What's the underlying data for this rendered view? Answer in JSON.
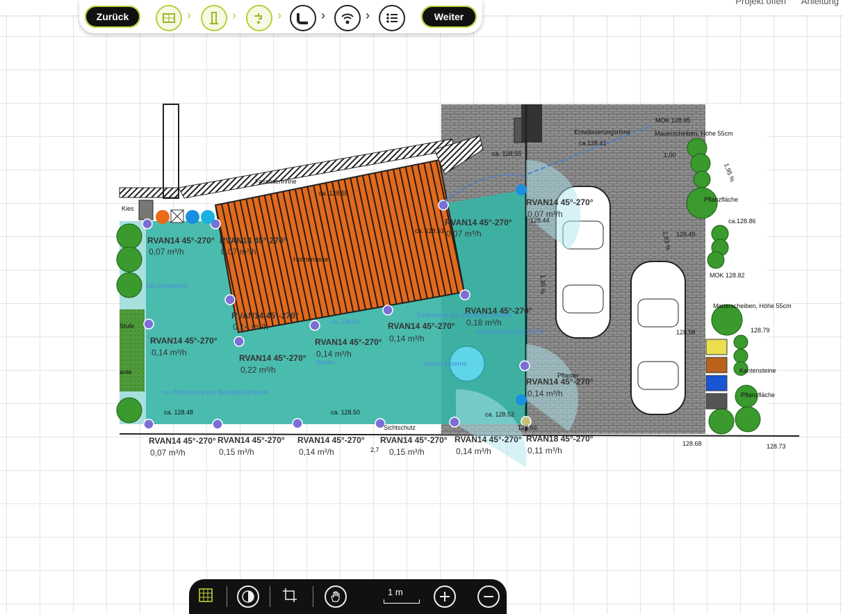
{
  "toplinks": [
    "Projekt öffen",
    "Anleitung"
  ],
  "wizard": {
    "back_label": "Zurück",
    "next_label": "Weiter",
    "steps": [
      {
        "icon": "area-icon",
        "state": "done"
      },
      {
        "icon": "water-source-icon",
        "state": "done"
      },
      {
        "icon": "tap-icon",
        "state": "done"
      },
      {
        "icon": "pipe-icon",
        "state": "todo"
      },
      {
        "icon": "wifi-drop-icon",
        "state": "todo"
      },
      {
        "icon": "list-icon",
        "state": "todo"
      }
    ]
  },
  "plan": {
    "areas": {
      "terrace": "Holzterrasse",
      "lawn": "Rasen",
      "cistern_cover": "Deckel Zisterne",
      "gutter": "Fassadenrinne",
      "gravel": "Kies",
      "step": "Stufe",
      "edge": "ante",
      "privacy": "KD-Sichtschutz",
      "privacy_bottom": "Sichtschutz",
      "border_top": "Einfassung aus Basaltgroßpflaster",
      "border_bottom": "ev- Einfassung aus Basaltgroßpflaster",
      "kantensteine_ok": "Kantensteine OK 128.52",
      "drain": "Entwässerungsrinne",
      "paving": "Pflaster",
      "wall_top": "Mauerscheiben, Höhe 55cm",
      "wall_mid": "Mauerscheiben, Höhe 55cm",
      "plant_top": "Pflanzfläche",
      "plant_bottom": "Pflanzfläche",
      "kanten_right": "Kantensteine",
      "mok_top": "MOK 128.95",
      "mok_mid": "MOK 128.82"
    },
    "heights": {
      "h1": "ca. 128.55",
      "h2": "ca. 128.55",
      "h3": "ca. 128.53",
      "h4": "ca.128.41",
      "h5": "ca. 128.50",
      "h6": "ca. 128.48",
      "h7": "ca. 128.50",
      "h8": "ca. 128.52",
      "h9": "128.44",
      "h10": "128.49",
      "h11": "128.58",
      "h12": "ca.128.86",
      "h13": "128.79",
      "h14": "128.68",
      "h15": "128.73",
      "h16": "128.63",
      "h17": "1,00",
      "h18": "2,7"
    },
    "slopes": [
      "1,95 %",
      "2,93 %",
      "1,35 %"
    ],
    "sprinklers": [
      {
        "model": "RVAN14 45°-270°",
        "flow": "0,07 m³/h"
      },
      {
        "model": "RVAN14 45°-270°",
        "flow": "0,07 m³/h"
      },
      {
        "model": "RVAN14 45°-270°",
        "flow": "0,07 m³/h"
      },
      {
        "model": "RVAN14 45°-270°",
        "flow": "0,14 m³/h"
      },
      {
        "model": "RVAN14 45°-270°",
        "flow": "0,14 m³/h"
      },
      {
        "model": "RVAN14 45°-270°",
        "flow": "0,22 m³/h"
      },
      {
        "model": "RVAN14 45°-270°",
        "flow": "0,14 m³/h"
      },
      {
        "model": "RVAN14 45°-270°",
        "flow": "0,14 m³/h"
      },
      {
        "model": "RVAN14 45°-270°",
        "flow": "0,18 m³/h"
      },
      {
        "model": "RVAN14 45°-270°",
        "flow": "0,07 m³/h"
      },
      {
        "model": "RVAN14 45°-270°",
        "flow": "0,14 m³/h"
      },
      {
        "model": "RVAN14 45°-270°",
        "flow": "0,07 m³/h"
      },
      {
        "model": "RVAN14 45°-270°",
        "flow": "0,15 m³/h"
      },
      {
        "model": "RVAN14 45°-270°",
        "flow": "0,14 m³/h"
      },
      {
        "model": "RVAN14 45°-270°",
        "flow": "0,15 m³/h"
      },
      {
        "model": "RVAN14 45°-270°",
        "flow": "0,14 m³/h"
      },
      {
        "model": "RVAN18 45°-270°",
        "flow": "0,11 m³/h"
      }
    ]
  },
  "toolbar": {
    "tools": [
      "grid-icon",
      "contrast-icon",
      "crop-icon",
      "hand-icon"
    ],
    "scale_label": "1 m",
    "zoom_in": "zoom-in-icon",
    "zoom_out": "zoom-out-icon"
  },
  "colors": {
    "accent": "#c7d83b",
    "lawn": "#2fb3a8",
    "terrace": "#e0671f",
    "paving": "#9a9a9a",
    "sprinkler": "#7b6fd6"
  }
}
